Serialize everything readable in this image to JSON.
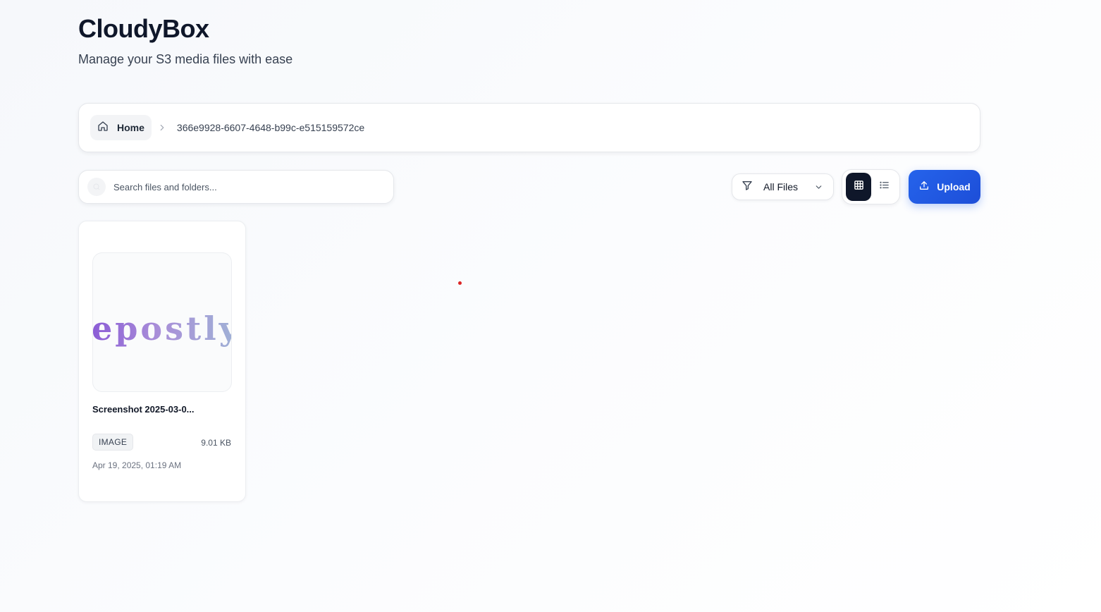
{
  "header": {
    "title": "CloudyBox",
    "subtitle": "Manage your S3 media files with ease"
  },
  "breadcrumb": {
    "home_label": "Home",
    "current": "366e9928-6607-4648-b99c-e515159572ce"
  },
  "toolbar": {
    "search_placeholder": "Search files and folders...",
    "filter_label": "All Files",
    "view_mode": "grid",
    "upload_label": "Upload"
  },
  "files": [
    {
      "name": "Screenshot 2025-03-0...",
      "type": "IMAGE",
      "size": "9.01 KB",
      "date": "Apr 19, 2025, 01:19 AM",
      "thumbnail_text": "epostly"
    }
  ],
  "colors": {
    "accent": "#2563eb",
    "dark": "#0f172a",
    "cursor": "#dc2626"
  }
}
